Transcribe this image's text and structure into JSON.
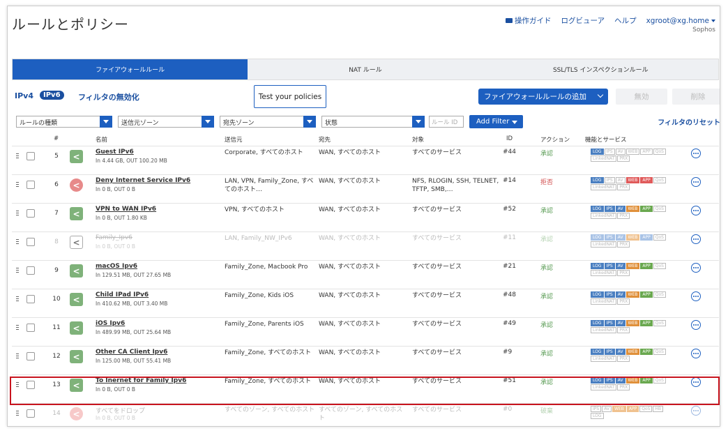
{
  "page": {
    "title": "ルールとポリシー"
  },
  "topnav": {
    "guide": "操作ガイド",
    "log_viewer": "ログビューア",
    "help": "ヘルプ",
    "user": "xgroot@xg.home",
    "sub": "Sophos"
  },
  "tabs": [
    {
      "label": "ファイアウォールルール",
      "active": true
    },
    {
      "label": "NAT ルール",
      "active": false
    },
    {
      "label": "SSL/TLS インスペクションルール",
      "active": false
    }
  ],
  "toolbar": {
    "ipv4": "IPv4",
    "ipv6": "IPv6",
    "disable_filter": "フィルタの無効化",
    "test_policies": "Test your policies",
    "add_rule": "ファイアウォールルールの追加",
    "disable": "無効",
    "delete": "削除"
  },
  "filters": {
    "rule_type": "ルールの種類",
    "src_zone": "送信元ゾーン",
    "dst_zone": "宛先ゾーン",
    "status": "状態",
    "rule_id_placeholder": "ルール ID",
    "add_filter": "Add Filter",
    "reset": "フィルタのリセット"
  },
  "table": {
    "columns": [
      "#",
      "名前",
      "送信元",
      "宛先",
      "対象",
      "ID",
      "アクション",
      "機能とサービス"
    ],
    "rows": [
      {
        "num": "5",
        "name": "Guest IPv6",
        "meta": "In 4.44 GB, OUT 100.20 MB",
        "source": "Corporate, すべてのホスト",
        "dest": "WAN, すべてのホスト",
        "service": "すべてのサービス",
        "id": "#44",
        "action": "承認",
        "icon": "allow"
      },
      {
        "num": "6",
        "name": "Deny Internet Service IPv6",
        "meta": "In 0 B, OUT 0 B",
        "source": "LAN, VPN, Family_Zone, すべてのホスト…",
        "dest": "WAN, すべてのホスト",
        "service": "NFS, RLOGIN, SSH, TELNET, TFTP, SMB,…",
        "id": "#14",
        "action": "拒否",
        "icon": "deny"
      },
      {
        "num": "7",
        "name": "VPN to WAN IPv6",
        "meta": "In 0 B, OUT 1.80 KB",
        "source": "VPN, すべてのホスト",
        "dest": "WAN, すべてのホスト",
        "service": "すべてのサービス",
        "id": "#52",
        "action": "承認",
        "icon": "allow"
      },
      {
        "num": "8",
        "name": "Family_Ipv6",
        "meta": "In 0 B, OUT 0 B",
        "source": "LAN, Family_NW_IPv6",
        "dest": "WAN, すべてのホスト",
        "service": "すべてのサービス",
        "id": "#11",
        "action": "承認",
        "icon": "off"
      },
      {
        "num": "9",
        "name": "macOS Ipv6",
        "meta": "In 129.51 MB, OUT 27.65 MB",
        "source": "Family_Zone, Macbook Pro",
        "dest": "WAN, すべてのホスト",
        "service": "すべてのサービス",
        "id": "#21",
        "action": "承認",
        "icon": "allow"
      },
      {
        "num": "10",
        "name": "Child IPad IPv6",
        "meta": "In 410.62 MB, OUT 3.40 MB",
        "source": "Family_Zone, Kids iOS",
        "dest": "WAN, すべてのホスト",
        "service": "すべてのサービス",
        "id": "#48",
        "action": "承認",
        "icon": "allow"
      },
      {
        "num": "11",
        "name": "iOS Ipv6",
        "meta": "In 489.99 MB, OUT 25.64 MB",
        "source": "Family_Zone, Parents iOS",
        "dest": "WAN, すべてのホスト",
        "service": "すべてのサービス",
        "id": "#49",
        "action": "承認",
        "icon": "allow"
      },
      {
        "num": "12",
        "name": "Other CA Client Ipv6",
        "meta": "In 125.00 MB, OUT 55.41 MB",
        "source": "Family_Zone, すべてのホスト",
        "dest": "WAN, すべてのホスト",
        "service": "すべてのサービス",
        "id": "#9",
        "action": "承認",
        "icon": "allow"
      },
      {
        "num": "13",
        "name": "To Inernet for Family Ipv6",
        "meta": "In 0 B, OUT 0 B",
        "source": "Family_Zone, すべてのホスト",
        "dest": "WAN, すべてのホスト",
        "service": "すべてのサービス",
        "id": "#51",
        "action": "承認",
        "icon": "allow"
      },
      {
        "num": "14",
        "name": "すべてをドロップ",
        "meta": "In 0 B, OUT 0 B",
        "source": "すべてのゾーン, すべてのホスト",
        "dest": "すべてのゾーン, すべてのホスト",
        "service": "すべてのサービス",
        "id": "#0",
        "action": "破棄",
        "icon": "drop"
      }
    ],
    "badges": {
      "log": "LOG",
      "ips": "IPS",
      "av": "AV",
      "web": "WEB",
      "app": "APP",
      "qos": "QoS",
      "linked_nat": "LinkedNAT",
      "prx": "PRX",
      "hb": "HB"
    }
  },
  "colors": {
    "accent": "#1d5fc0",
    "allow": "#7fb27a",
    "deny": "#e78a8a",
    "highlight": "#c8141e"
  }
}
